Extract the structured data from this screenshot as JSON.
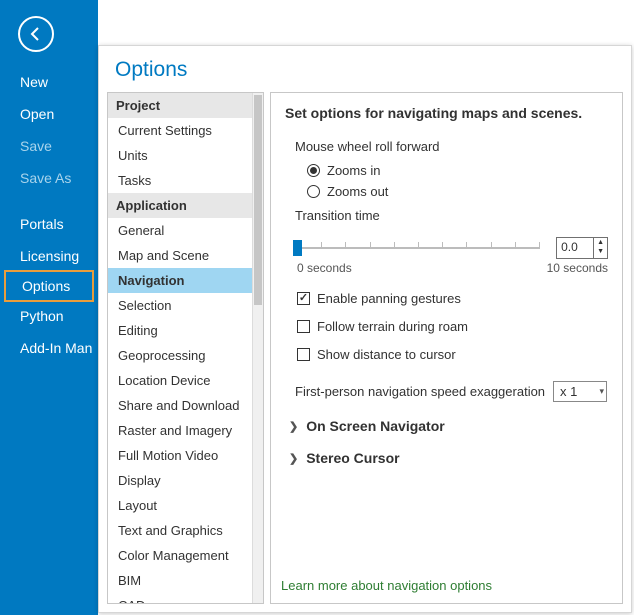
{
  "nav": {
    "items": [
      {
        "label": "New"
      },
      {
        "label": "Open"
      },
      {
        "label": "Save",
        "disabled": true
      },
      {
        "label": "Save As",
        "disabled": true
      }
    ],
    "items2": [
      {
        "label": "Portals"
      },
      {
        "label": "Licensing"
      },
      {
        "label": "Options",
        "selected": true
      },
      {
        "label": "Python"
      },
      {
        "label": "Add-In Man"
      }
    ]
  },
  "dialog": {
    "title": "Options",
    "tree": {
      "project_header": "Project",
      "project_items": [
        "Current Settings",
        "Units",
        "Tasks"
      ],
      "app_header": "Application",
      "app_items": [
        "General",
        "Map and Scene",
        "Navigation",
        "Selection",
        "Editing",
        "Geoprocessing",
        "Location Device",
        "Share and Download",
        "Raster and Imagery",
        "Full Motion Video",
        "Display",
        "Layout",
        "Text and Graphics",
        "Color Management",
        "BIM",
        "CAD"
      ],
      "selected": "Navigation"
    },
    "content": {
      "heading": "Set options for navigating maps and scenes.",
      "mouse_wheel_label": "Mouse wheel roll forward",
      "radio_in": "Zooms in",
      "radio_out": "Zooms out",
      "mouse_wheel_selected": "Zooms in",
      "transition_label": "Transition time",
      "transition_value": "0.0",
      "slider_min_label": "0 seconds",
      "slider_max_label": "10 seconds",
      "check_panning": "Enable panning gestures",
      "check_panning_on": true,
      "check_terrain": "Follow terrain during roam",
      "check_terrain_on": false,
      "check_distance": "Show distance to cursor",
      "check_distance_on": false,
      "fps_label": "First-person navigation speed exaggeration",
      "fps_value": "x 1",
      "exp_navigator": "On Screen Navigator",
      "exp_stereo": "Stereo Cursor",
      "learn_more": "Learn more about navigation options"
    }
  }
}
